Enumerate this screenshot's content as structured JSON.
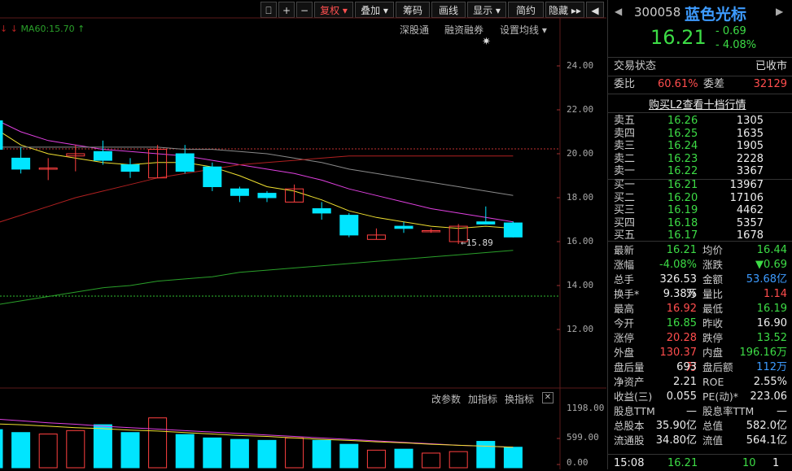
{
  "toolbar": {
    "buttons": [
      "复权",
      "叠加",
      "筹码",
      "画线",
      "显示",
      "简约",
      "隐藏"
    ]
  },
  "ma_label": "MA60:15.70",
  "menus": [
    "深股通",
    "融资融券",
    "设置均线"
  ],
  "y_ticks": [
    "24.00",
    "22.00",
    "20.00",
    "18.00",
    "16.00",
    "14.00",
    "12.00"
  ],
  "low_marker": "15.89",
  "volume_panel": {
    "menus": [
      "改参数",
      "加指标",
      "换指标"
    ],
    "ticks": [
      "1198.00",
      "599.00",
      "0.00"
    ]
  },
  "chart_data": {
    "type": "candlestick",
    "ylim": [
      11,
      25
    ],
    "candles": [
      {
        "o": 21.5,
        "c": 20.2,
        "h": 22.0,
        "l": 19.9
      },
      {
        "o": 19.8,
        "c": 19.3,
        "h": 20.3,
        "l": 19.1
      },
      {
        "o": 19.3,
        "c": 19.35,
        "h": 19.8,
        "l": 18.8
      },
      {
        "o": 19.9,
        "c": 20.0,
        "h": 20.4,
        "l": 19.2
      },
      {
        "o": 20.1,
        "c": 19.7,
        "h": 20.6,
        "l": 19.5
      },
      {
        "o": 19.5,
        "c": 19.2,
        "h": 19.8,
        "l": 18.9
      },
      {
        "o": 18.9,
        "c": 20.2,
        "h": 20.4,
        "l": 18.9
      },
      {
        "o": 20.0,
        "c": 19.2,
        "h": 20.4,
        "l": 19.1
      },
      {
        "o": 19.4,
        "c": 18.5,
        "h": 19.6,
        "l": 18.3
      },
      {
        "o": 18.4,
        "c": 18.1,
        "h": 18.5,
        "l": 17.8
      },
      {
        "o": 18.2,
        "c": 18.0,
        "h": 18.3,
        "l": 17.8
      },
      {
        "o": 17.8,
        "c": 18.4,
        "h": 18.6,
        "l": 17.8
      },
      {
        "o": 17.5,
        "c": 17.3,
        "h": 17.8,
        "l": 17.0
      },
      {
        "o": 17.2,
        "c": 16.3,
        "h": 17.3,
        "l": 16.2
      },
      {
        "o": 16.1,
        "c": 16.3,
        "h": 16.6,
        "l": 16.1
      },
      {
        "o": 16.7,
        "c": 16.6,
        "h": 16.9,
        "l": 16.4
      },
      {
        "o": 16.5,
        "c": 16.5,
        "h": 16.6,
        "l": 16.4
      },
      {
        "o": 16.0,
        "c": 16.7,
        "h": 16.8,
        "l": 15.89
      },
      {
        "o": 16.9,
        "c": 16.8,
        "h": 17.6,
        "l": 16.8
      },
      {
        "o": 16.85,
        "c": 16.21,
        "h": 16.92,
        "l": 16.19
      }
    ],
    "ma_lines": [
      {
        "name": "MA5",
        "color": "#f0e030",
        "values": [
          21.2,
          20.4,
          20.0,
          19.8,
          19.6,
          19.5,
          19.6,
          19.6,
          19.4,
          19.0,
          18.5,
          18.3,
          17.9,
          17.4,
          17.1,
          16.9,
          16.7,
          16.6,
          16.7,
          16.6
        ]
      },
      {
        "name": "MA10",
        "color": "#e040e0",
        "values": [
          21.6,
          21.0,
          20.6,
          20.4,
          20.2,
          20.1,
          20.0,
          19.9,
          19.7,
          19.5,
          19.3,
          19.1,
          18.8,
          18.4,
          18.1,
          17.8,
          17.5,
          17.3,
          17.1,
          16.9
        ]
      },
      {
        "name": "MA20",
        "color": "#8a8a8a",
        "values": [
          20.3,
          20.3,
          20.3,
          20.3,
          20.3,
          20.3,
          20.3,
          20.2,
          20.2,
          20.1,
          20.0,
          19.8,
          19.6,
          19.3,
          19.1,
          18.9,
          18.7,
          18.5,
          18.3,
          18.1
        ]
      },
      {
        "name": "MA30",
        "color": "#b02020",
        "values": [
          16.8,
          17.2,
          17.6,
          18.0,
          18.3,
          18.6,
          18.9,
          19.1,
          19.3,
          19.5,
          19.6,
          19.7,
          19.8,
          19.9,
          19.9,
          19.9,
          19.9,
          19.9,
          19.9,
          19.9
        ]
      },
      {
        "name": "MA60",
        "color": "#2aa02a",
        "values": [
          13.1,
          13.3,
          13.5,
          13.7,
          13.9,
          14.0,
          14.2,
          14.3,
          14.4,
          14.6,
          14.7,
          14.8,
          14.9,
          15.0,
          15.1,
          15.2,
          15.3,
          15.4,
          15.5,
          15.6
        ]
      }
    ],
    "volume": {
      "ylim": [
        0,
        1198
      ],
      "values": [
        780,
        720,
        690,
        760,
        880,
        720,
        1020,
        680,
        610,
        580,
        560,
        610,
        560,
        480,
        360,
        380,
        300,
        330,
        540,
        420
      ],
      "ma_a": [
        1000,
        960,
        920,
        890,
        850,
        820,
        790,
        760,
        730,
        700,
        670,
        640,
        610,
        580,
        550,
        520,
        490,
        460,
        440,
        420
      ],
      "ma_b": [
        900,
        880,
        850,
        820,
        800,
        770,
        750,
        720,
        690,
        660,
        640,
        610,
        580,
        560,
        530,
        510,
        480,
        460,
        440,
        420
      ]
    }
  },
  "quote": {
    "code": "300058",
    "name": "蓝色光标",
    "price": "16.21",
    "change": "- 0.69",
    "change_pct": "- 4.08%",
    "status_label": "交易状态",
    "status_value": "已收市",
    "webi_label": "委比",
    "webi_value": "60.61%",
    "weicha_label": "委差",
    "weicha_value": "32129",
    "l2_link": "购买L2查看十档行情",
    "asks": [
      {
        "label": "卖五",
        "price": "16.26",
        "vol": "1305"
      },
      {
        "label": "卖四",
        "price": "16.25",
        "vol": "1635"
      },
      {
        "label": "卖三",
        "price": "16.24",
        "vol": "1905"
      },
      {
        "label": "卖二",
        "price": "16.23",
        "vol": "2228"
      },
      {
        "label": "卖一",
        "price": "16.22",
        "vol": "3367"
      }
    ],
    "bids": [
      {
        "label": "买一",
        "price": "16.21",
        "vol": "13967"
      },
      {
        "label": "买二",
        "price": "16.20",
        "vol": "17106"
      },
      {
        "label": "买三",
        "price": "16.19",
        "vol": "4462"
      },
      {
        "label": "买四",
        "price": "16.18",
        "vol": "5357"
      },
      {
        "label": "买五",
        "price": "16.17",
        "vol": "1678"
      }
    ],
    "stats": [
      {
        "l1": "最新",
        "v1": "16.21",
        "c1": "green",
        "l2": "均价",
        "v2": "16.44",
        "c2": "green"
      },
      {
        "l1": "涨幅",
        "v1": "-4.08%",
        "c1": "green",
        "l2": "涨跌",
        "v2": "▼0.69",
        "c2": "green"
      },
      {
        "l1": "总手",
        "v1": "326.53万",
        "c1": "white",
        "l2": "金额",
        "v2": "53.68亿",
        "c2": "blue"
      },
      {
        "l1": "换手*",
        "v1": "9.38%",
        "c1": "white",
        "l2": "量比",
        "v2": "1.14",
        "c2": "red"
      },
      {
        "l1": "最高",
        "v1": "16.92",
        "c1": "red",
        "l2": "最低",
        "v2": "16.19",
        "c2": "green"
      },
      {
        "l1": "今开",
        "v1": "16.85",
        "c1": "green",
        "l2": "昨收",
        "v2": "16.90",
        "c2": "white"
      },
      {
        "l1": "涨停",
        "v1": "20.28",
        "c1": "red",
        "l2": "跌停",
        "v2": "13.52",
        "c2": "green"
      },
      {
        "l1": "外盘",
        "v1": "130.37万",
        "c1": "red",
        "l2": "内盘",
        "v2": "196.16万",
        "c2": "green"
      },
      {
        "l1": "盘后量",
        "v1": "693",
        "c1": "white",
        "l2": "盘后额",
        "v2": "112万",
        "c2": "blue"
      },
      {
        "l1": "净资产",
        "v1": "2.21",
        "c1": "white",
        "l2": "ROE",
        "v2": "2.55%",
        "c2": "white"
      },
      {
        "l1": "收益(三)",
        "v1": "0.055",
        "c1": "white",
        "l2": "PE(动)*",
        "v2": "223.06",
        "c2": "white"
      },
      {
        "l1": "股息TTM",
        "v1": "—",
        "c1": "white",
        "l2": "股息率TTM",
        "v2": "—",
        "c2": "white"
      },
      {
        "l1": "总股本",
        "v1": "35.90亿",
        "c1": "white",
        "l2": "总值",
        "v2": "582.0亿",
        "c2": "white"
      },
      {
        "l1": "流通股",
        "v1": "34.80亿",
        "c1": "white",
        "l2": "流值",
        "v2": "564.1亿",
        "c2": "white"
      }
    ],
    "tick": {
      "time": "15:08",
      "price": "16.21",
      "vol": "10",
      "num": "1"
    }
  },
  "colors": {
    "up": "#ff4040",
    "down": "#00e5ff",
    "grid": "#5a1a1a"
  }
}
